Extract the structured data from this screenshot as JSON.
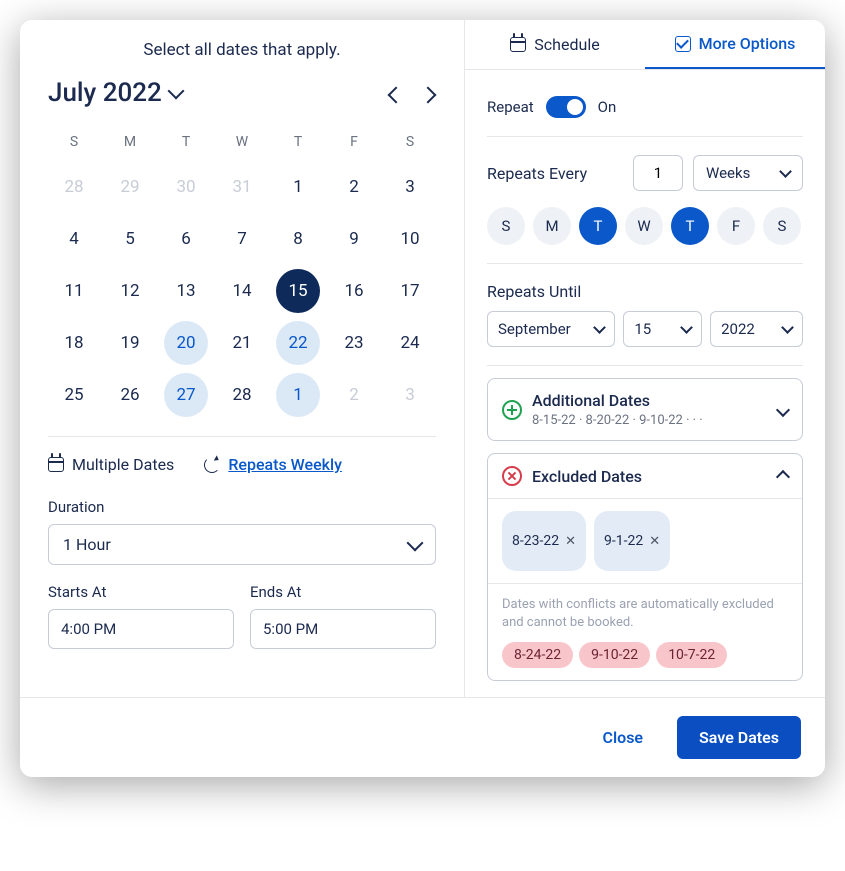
{
  "instruction": "Select all dates that apply.",
  "calendar": {
    "month_label": "July 2022",
    "dow": [
      "S",
      "M",
      "T",
      "W",
      "T",
      "F",
      "S"
    ],
    "days": [
      {
        "n": "28",
        "muted": true
      },
      {
        "n": "29",
        "muted": true
      },
      {
        "n": "30",
        "muted": true
      },
      {
        "n": "31",
        "muted": true
      },
      {
        "n": "1"
      },
      {
        "n": "2"
      },
      {
        "n": "3"
      },
      {
        "n": "4"
      },
      {
        "n": "5"
      },
      {
        "n": "6"
      },
      {
        "n": "7"
      },
      {
        "n": "8"
      },
      {
        "n": "9"
      },
      {
        "n": "10"
      },
      {
        "n": "11"
      },
      {
        "n": "12"
      },
      {
        "n": "13"
      },
      {
        "n": "14"
      },
      {
        "n": "15",
        "primary": true
      },
      {
        "n": "16"
      },
      {
        "n": "17"
      },
      {
        "n": "18"
      },
      {
        "n": "19"
      },
      {
        "n": "20",
        "secondary": true
      },
      {
        "n": "21"
      },
      {
        "n": "22",
        "secondary": true
      },
      {
        "n": "23"
      },
      {
        "n": "24"
      },
      {
        "n": "25"
      },
      {
        "n": "26"
      },
      {
        "n": "27",
        "secondary": true
      },
      {
        "n": "28"
      },
      {
        "n": "1",
        "secondary": true
      },
      {
        "n": "2",
        "muted": true
      },
      {
        "n": "3",
        "muted": true
      }
    ]
  },
  "options": {
    "multiple_dates": "Multiple Dates",
    "repeats_weekly": "Repeats Weekly"
  },
  "duration": {
    "label": "Duration",
    "value": "1 Hour"
  },
  "starts_at": {
    "label": "Starts At",
    "value": "4:00 PM"
  },
  "ends_at": {
    "label": "Ends At",
    "value": "5:00 PM"
  },
  "tabs": {
    "schedule": "Schedule",
    "more_options": "More Options"
  },
  "repeat": {
    "label": "Repeat",
    "state": "On"
  },
  "repeats_every": {
    "label": "Repeats Every",
    "count": "1",
    "unit": "Weeks",
    "days": [
      {
        "l": "S",
        "on": false
      },
      {
        "l": "M",
        "on": false
      },
      {
        "l": "T",
        "on": true
      },
      {
        "l": "W",
        "on": false
      },
      {
        "l": "T",
        "on": true
      },
      {
        "l": "F",
        "on": false
      },
      {
        "l": "S",
        "on": false
      }
    ]
  },
  "repeats_until": {
    "label": "Repeats Until",
    "month": "September",
    "day": "15",
    "year": "2022"
  },
  "additional_dates": {
    "title": "Additional Dates",
    "summary": "8-15-22 · 8-20-22 · 9-10-22 · · ·"
  },
  "excluded_dates": {
    "title": "Excluded Dates",
    "chips": [
      "8-23-22",
      "9-1-22"
    ],
    "helper": "Dates with conflicts are automatically excluded and cannot be booked.",
    "conflicts": [
      "8-24-22",
      "9-10-22",
      "10-7-22"
    ]
  },
  "footer": {
    "close": "Close",
    "save": "Save Dates"
  }
}
